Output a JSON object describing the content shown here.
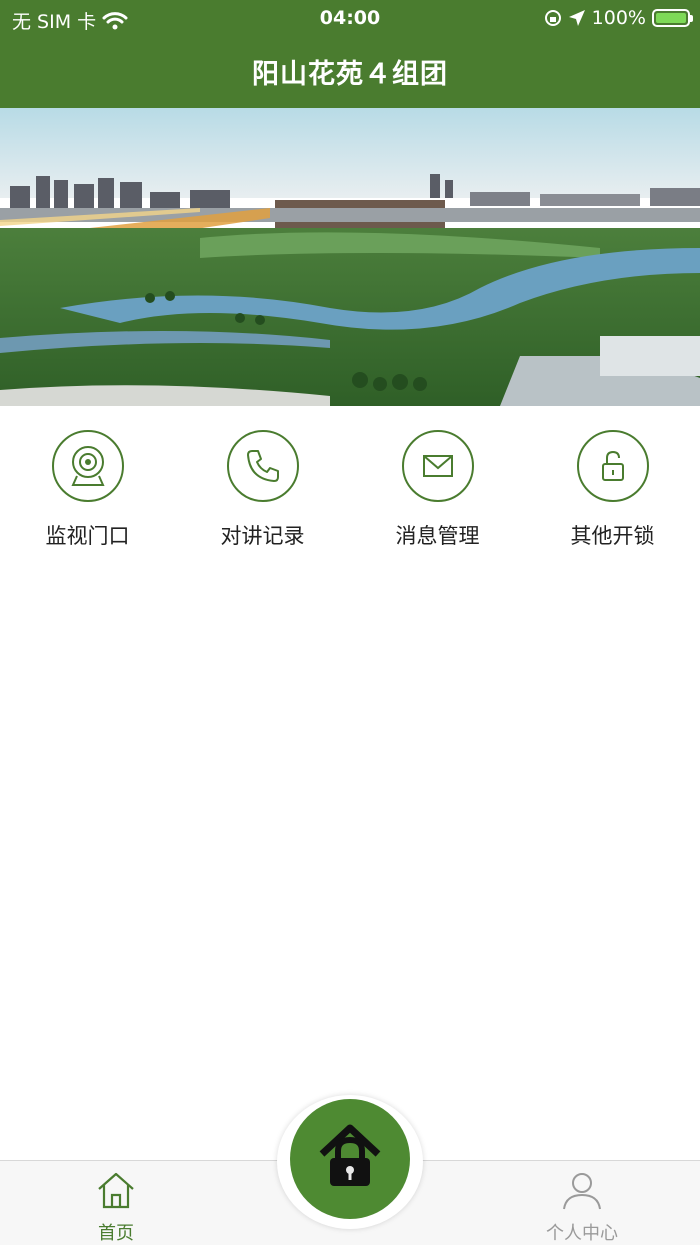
{
  "status_bar": {
    "carrier": "无 SIM 卡",
    "time": "04:00",
    "battery": "100%"
  },
  "header": {
    "title": "阳山花苑４组团"
  },
  "menu": [
    {
      "label": "监视门口",
      "icon": "camera-icon"
    },
    {
      "label": "对讲记录",
      "icon": "phone-icon"
    },
    {
      "label": "消息管理",
      "icon": "mail-icon"
    },
    {
      "label": "其他开锁",
      "icon": "unlock-icon"
    }
  ],
  "tabbar": {
    "home_label": "首页",
    "profile_label": "个人中心",
    "center_icon": "lock-house-icon"
  },
  "colors": {
    "primary": "#4a7c2f",
    "tab_inactive": "#999999"
  }
}
